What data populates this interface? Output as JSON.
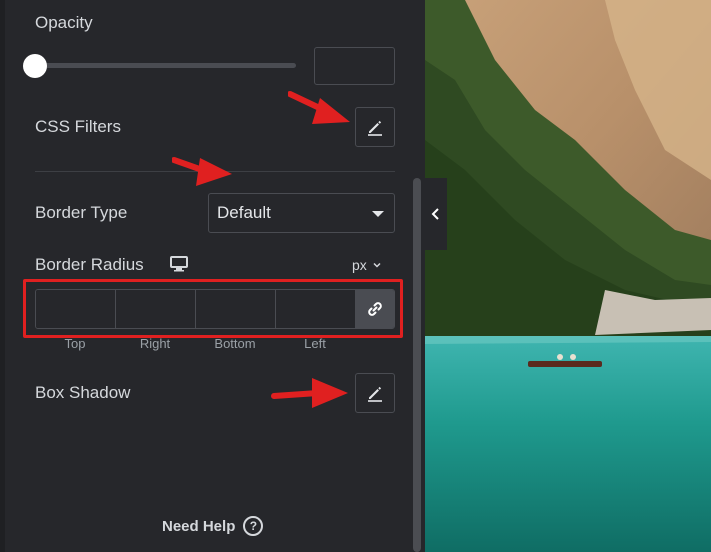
{
  "opacity": {
    "label": "Opacity",
    "value": ""
  },
  "css_filters": {
    "label": "CSS Filters",
    "icon": "pencil-icon"
  },
  "border_type": {
    "label": "Border Type",
    "selected": "Default"
  },
  "border_radius": {
    "label": "Border Radius",
    "device_icon": "desktop-icon",
    "unit": "px",
    "fields": {
      "top": "Top",
      "right": "Right",
      "bottom": "Bottom",
      "left": "Left"
    },
    "link_icon": "link-icon"
  },
  "box_shadow": {
    "label": "Box Shadow",
    "icon": "pencil-icon"
  },
  "help": {
    "label": "Need Help",
    "icon": "question-circle-icon"
  },
  "colors": {
    "panel": "#26272b",
    "border": "#4a4c52",
    "text": "#d5d8dc",
    "annotation": "#e02020"
  }
}
